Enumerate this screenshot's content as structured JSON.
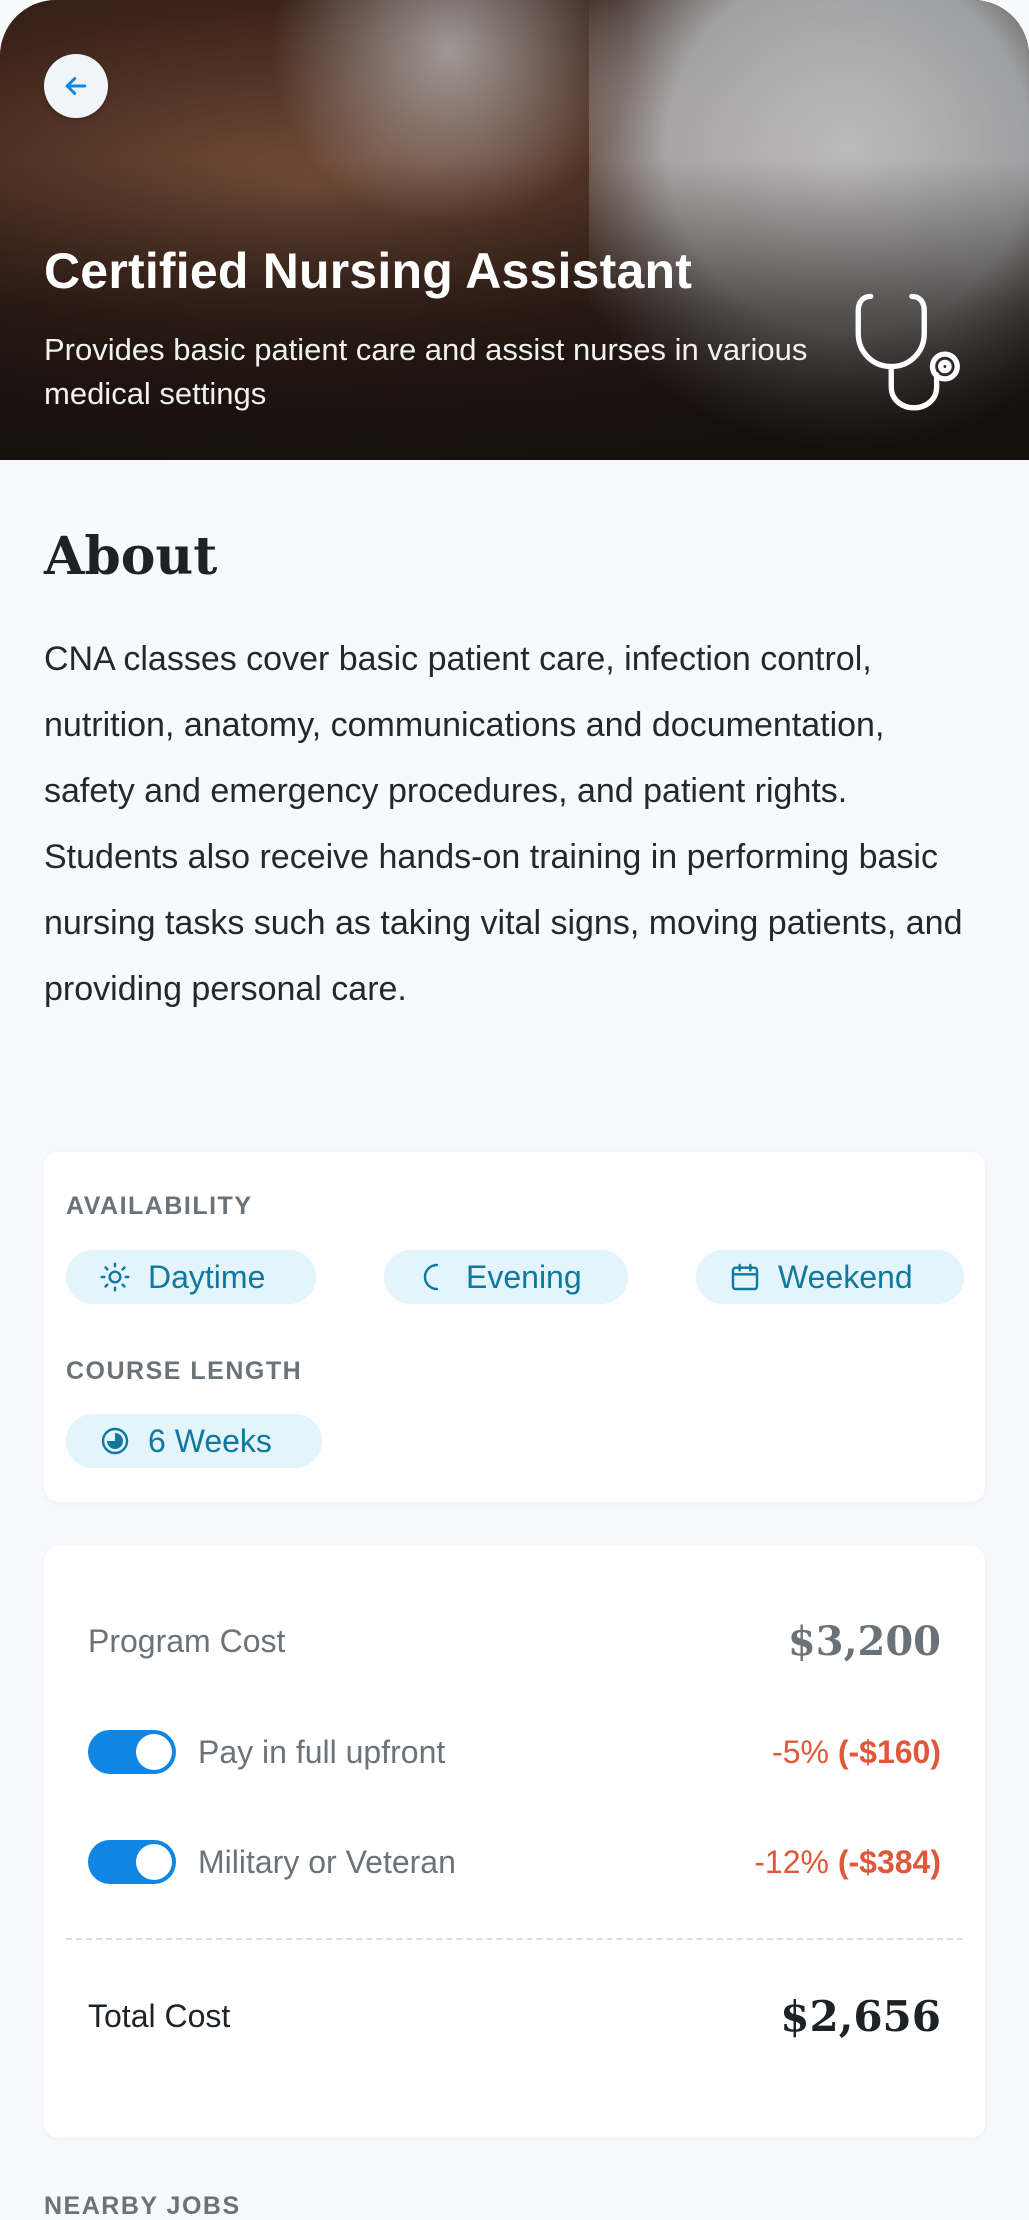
{
  "hero": {
    "title": "Certified Nursing Assistant",
    "subtitle": "Provides basic patient care and assist nurses in various medical settings",
    "back_icon": "arrow-left-icon",
    "category_icon": "stethoscope-icon"
  },
  "about": {
    "heading": "About",
    "body": "CNA classes cover basic patient care, infection control, nutrition, anatomy, communications and documentation, safety and emergency procedures, and patient rights. Students also receive hands-on training in performing basic nursing tasks such as taking vital signs, moving patients, and providing personal care."
  },
  "availability": {
    "label": "AVAILABILITY",
    "options": [
      {
        "label": "Daytime",
        "icon": "sun-icon"
      },
      {
        "label": "Evening",
        "icon": "moon-icon"
      },
      {
        "label": "Weekend",
        "icon": "calendar-icon"
      }
    ]
  },
  "course_length": {
    "label": "COURSE LENGTH",
    "value": "6 Weeks",
    "icon": "clock-icon"
  },
  "cost": {
    "program_label": "Program Cost",
    "program_value": "$3,200",
    "discounts": [
      {
        "label": "Pay in full upfront",
        "percent": "-5%",
        "amount": "(-$160)",
        "enabled": true
      },
      {
        "label": "Military or Veteran",
        "percent": "-12%",
        "amount": "(-$384)",
        "enabled": true
      }
    ],
    "total_label": "Total Cost",
    "total_value": "$2,656"
  },
  "nearby": {
    "label": "NEARBY JOBS"
  },
  "colors": {
    "accent": "#0f86e3",
    "pill_bg": "#e3f4fa",
    "pill_text": "#10789f",
    "discount": "#e0583a"
  }
}
